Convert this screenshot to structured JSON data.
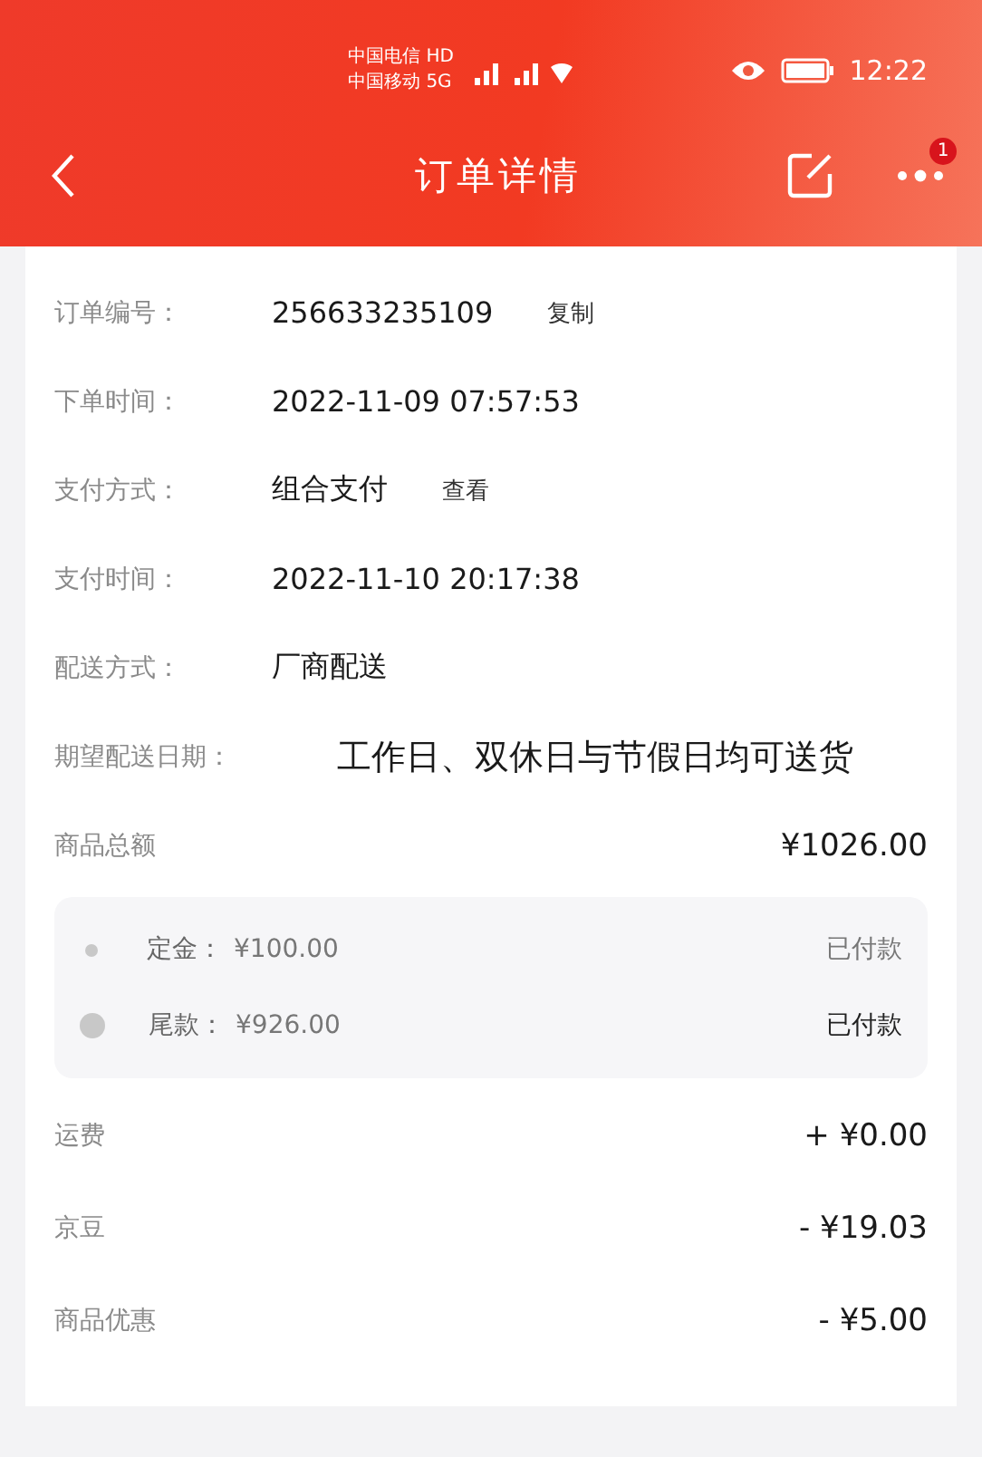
{
  "status_bar": {
    "carriers": [
      {
        "name": "中国电信",
        "badge": "HD"
      },
      {
        "name": "中国移动",
        "badge": "5G"
      }
    ],
    "time": "12:22"
  },
  "header": {
    "title": "订单详情",
    "badge": "1"
  },
  "info_rows": [
    {
      "label": "订单编号：",
      "value": "256633235109",
      "action": "复制"
    },
    {
      "label": "下单时间：",
      "value": "2022-11-09 07:57:53"
    },
    {
      "label": "支付方式：",
      "value": "组合支付",
      "action": "查看"
    },
    {
      "label": "支付时间：",
      "value": "2022-11-10 20:17:38"
    },
    {
      "label": "配送方式：",
      "value": "厂商配送"
    },
    {
      "label": "期望配送日期：",
      "value": "工作日、双休日与节假日均可送货"
    }
  ],
  "total": {
    "label": "商品总额",
    "amount": "¥1026.00"
  },
  "installments": [
    {
      "label": "定金：",
      "amount": "¥100.00",
      "status": "已付款",
      "current": false
    },
    {
      "label": "尾款：",
      "amount": "¥926.00",
      "status": "已付款",
      "current": true
    }
  ],
  "adjustments": [
    {
      "label": "运费",
      "amount": "+ ¥0.00"
    },
    {
      "label": "京豆",
      "amount": "- ¥19.03"
    },
    {
      "label": "商品优惠",
      "amount": "- ¥5.00"
    }
  ]
}
